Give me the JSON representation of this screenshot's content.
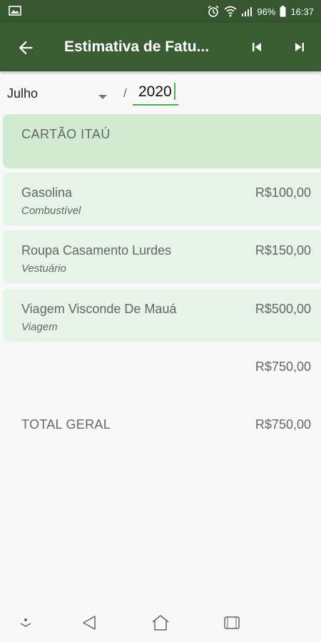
{
  "status": {
    "battery": "96%",
    "time": "16:37",
    "icons": [
      "image-icon",
      "alarm-icon",
      "wifi-icon",
      "signal-icon",
      "battery-icon"
    ]
  },
  "app_bar": {
    "title": "Estimativa de Fatu...",
    "icons": [
      "back-arrow-icon",
      "skip-previous-icon",
      "skip-next-icon"
    ],
    "background": "#3a5c32"
  },
  "filters": {
    "month": "Julho",
    "separator": "/",
    "year": "2020"
  },
  "card": {
    "title": "CARTÃO ITAÚ",
    "color": "#d1ebd3"
  },
  "items": [
    {
      "name": "Gasolina",
      "category": "Combustível",
      "amount": "R$100,00"
    },
    {
      "name": "Roupa Casamento Lurdes",
      "category": "Vestuário",
      "amount": "R$150,00"
    },
    {
      "name": "Viagem Visconde De Mauá",
      "category": "Viagem",
      "amount": "R$500,00"
    }
  ],
  "subtotal": "R$750,00",
  "total": {
    "label": "TOTAL GERAL",
    "value": "R$750,00"
  },
  "nav": {
    "icons": [
      "collapse-icon",
      "back-triangle-icon",
      "home-icon",
      "recents-icon"
    ]
  }
}
